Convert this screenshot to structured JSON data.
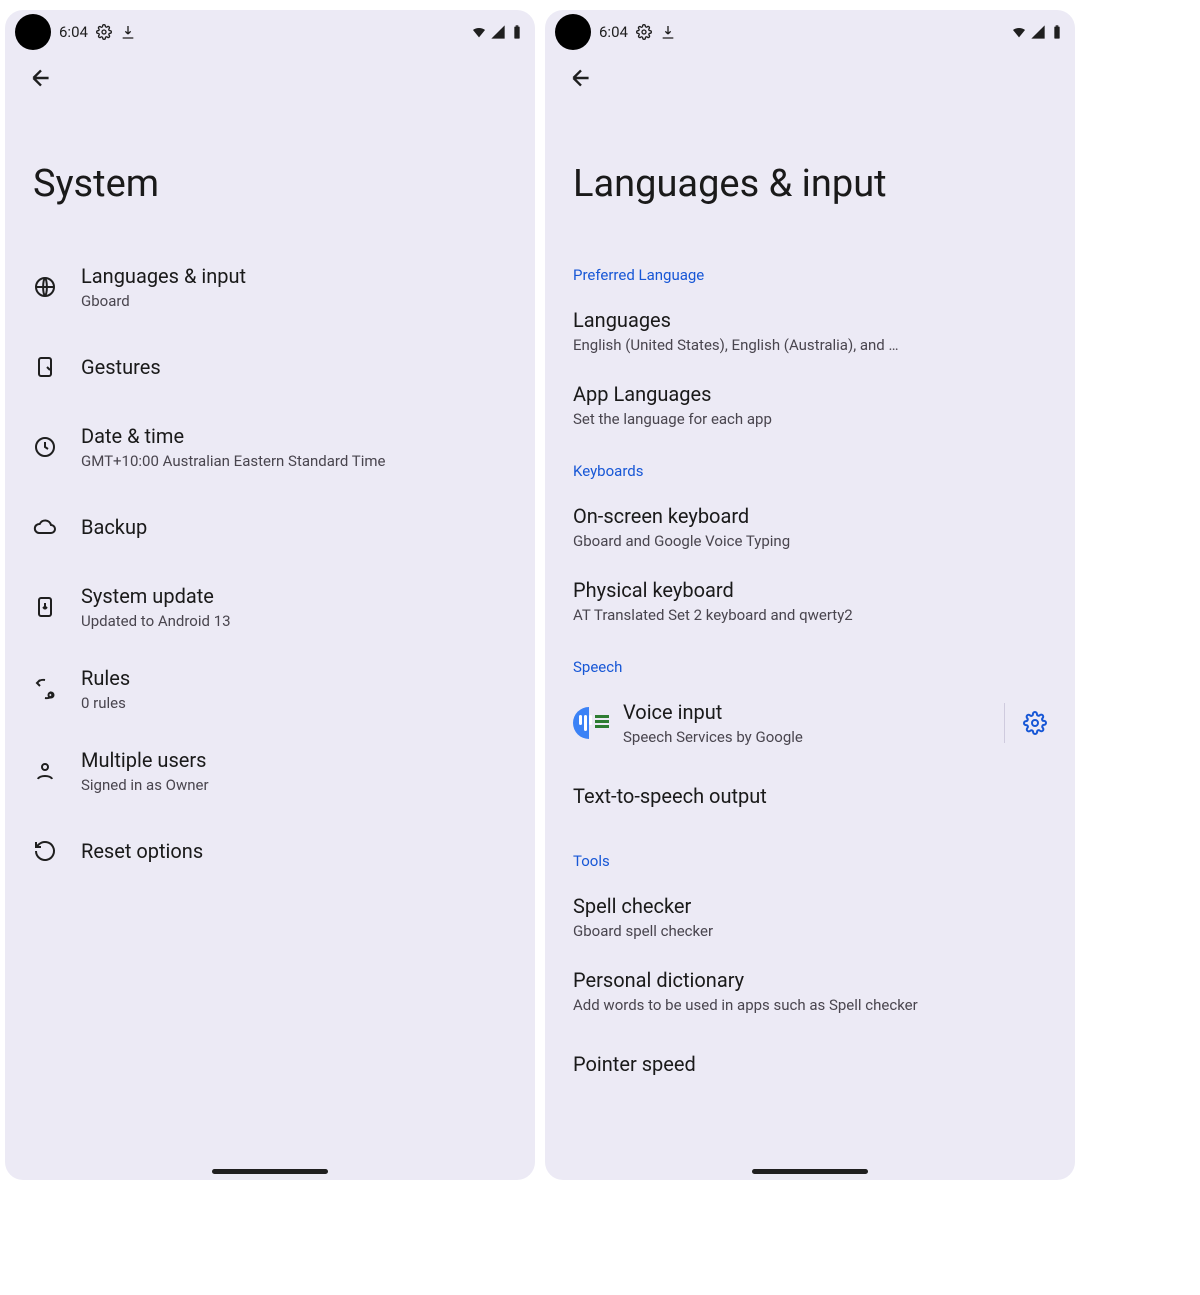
{
  "status": {
    "time": "6:04"
  },
  "left": {
    "title": "System",
    "items": [
      {
        "icon": "globe-icon",
        "title": "Languages & input",
        "sub": "Gboard"
      },
      {
        "icon": "gesture-icon",
        "title": "Gestures",
        "sub": ""
      },
      {
        "icon": "clock-icon",
        "title": "Date & time",
        "sub": "GMT+10:00 Australian Eastern Standard Time"
      },
      {
        "icon": "cloud-icon",
        "title": "Backup",
        "sub": ""
      },
      {
        "icon": "update-icon",
        "title": "System update",
        "sub": "Updated to Android 13"
      },
      {
        "icon": "rules-icon",
        "title": "Rules",
        "sub": "0 rules"
      },
      {
        "icon": "person-icon",
        "title": "Multiple users",
        "sub": "Signed in as Owner"
      },
      {
        "icon": "reset-icon",
        "title": "Reset options",
        "sub": ""
      }
    ]
  },
  "right": {
    "title": "Languages & input",
    "sections": [
      {
        "header": "Preferred Language",
        "items": [
          {
            "title": "Languages",
            "sub": "English (United States), English (Australia), and …"
          },
          {
            "title": "App Languages",
            "sub": "Set the language for each app"
          }
        ]
      },
      {
        "header": "Keyboards",
        "items": [
          {
            "title": "On-screen keyboard",
            "sub": "Gboard and Google Voice Typing"
          },
          {
            "title": "Physical keyboard",
            "sub": "AT Translated Set 2 keyboard and qwerty2"
          }
        ]
      },
      {
        "header": "Speech",
        "items": [
          {
            "title": "Voice input",
            "sub": "Speech Services by Google",
            "voice_icon": true,
            "gear": true
          },
          {
            "title": "Text-to-speech output",
            "sub": ""
          }
        ]
      },
      {
        "header": "Tools",
        "items": [
          {
            "title": "Spell checker",
            "sub": "Gboard spell checker"
          },
          {
            "title": "Personal dictionary",
            "sub": "Add words to be used in apps such as Spell checker"
          },
          {
            "title": "Pointer speed",
            "sub": ""
          }
        ]
      }
    ]
  }
}
